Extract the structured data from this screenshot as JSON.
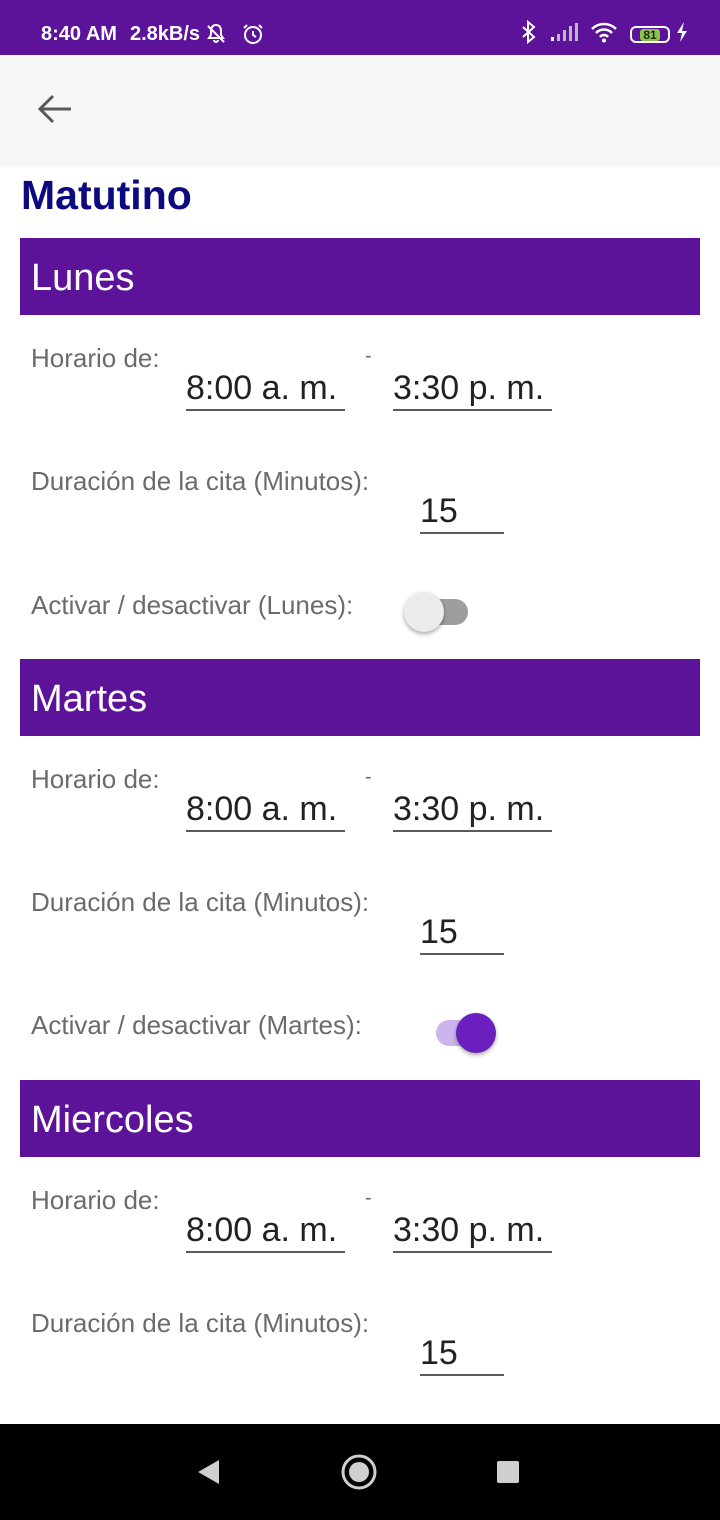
{
  "status_bar": {
    "time": "8:40 AM",
    "speed": "2.8kB/s",
    "battery": "81",
    "icons": [
      "notifications-off-icon",
      "alarm-icon",
      "bluetooth-icon",
      "signal-icon",
      "wifi-icon",
      "battery-icon",
      "charging-icon"
    ]
  },
  "app_bar": {
    "back_icon": "arrow-back-icon"
  },
  "page": {
    "title": "Matutino"
  },
  "days": [
    {
      "name": "Lunes",
      "schedule_label": "Horario de:",
      "separator": "-",
      "start_time": "8:00 a. m.",
      "end_time": "3:30 p. m.",
      "duration_label": "Duración de la cita (Minutos):",
      "duration": "15",
      "toggle_label": "Activar / desactivar (Lunes):",
      "active": false
    },
    {
      "name": "Martes",
      "schedule_label": "Horario de:",
      "separator": "-",
      "start_time": "8:00 a. m.",
      "end_time": "3:30 p. m.",
      "duration_label": "Duración de la cita (Minutos):",
      "duration": "15",
      "toggle_label": "Activar / desactivar (Martes):",
      "active": true
    },
    {
      "name": "Miercoles",
      "schedule_label": "Horario de:",
      "separator": "-",
      "start_time": "8:00 a. m.",
      "end_time": "3:30 p. m.",
      "duration_label": "Duración de la cita (Minutos):",
      "duration": "15"
    }
  ],
  "colors": {
    "primary": "#5c1399",
    "title": "#0c0a7e",
    "switch_on": "#6a1fbe"
  },
  "nav_bar": {
    "icons": [
      "back-triangle-icon",
      "home-circle-icon",
      "recents-square-icon"
    ]
  }
}
